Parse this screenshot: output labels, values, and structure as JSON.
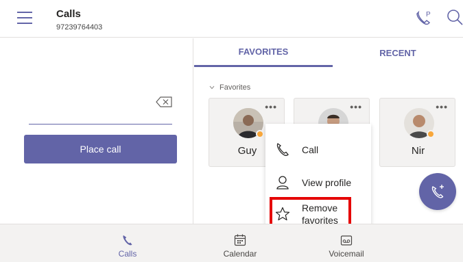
{
  "header": {
    "title": "Calls",
    "subtitle": "97239764403",
    "menu_icon": "hamburger-icon",
    "park_icon": "call-park-icon",
    "search_icon": "search-icon"
  },
  "dialer": {
    "input_value": "",
    "backspace_icon": "backspace-icon",
    "place_call_label": "Place call"
  },
  "tabs": {
    "favorites": "FAVORITES",
    "recent": "RECENT",
    "active": "favorites"
  },
  "favorites": {
    "section_label": "Favorites",
    "cards": [
      {
        "name": "Guy",
        "more": "•••"
      },
      {
        "name": "",
        "more": "•••"
      },
      {
        "name": "Nir",
        "more": "•••"
      }
    ]
  },
  "context_menu": {
    "call": "Call",
    "view_profile": "View profile",
    "remove_line1": "Remove",
    "remove_line2": "favorites"
  },
  "bottom_nav": {
    "calls": "Calls",
    "calendar": "Calendar",
    "voicemail": "Voicemail"
  },
  "colors": {
    "accent": "#6264a7",
    "highlight": "#e50000",
    "status_away": "#f8a73b"
  }
}
